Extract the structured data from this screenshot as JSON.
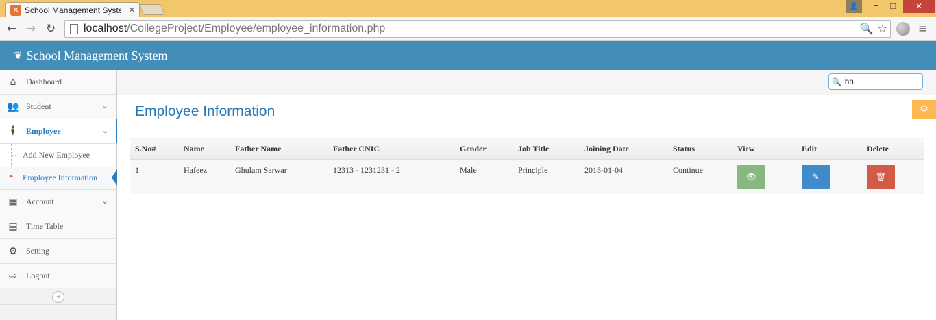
{
  "browser": {
    "tab_title": "School Management System",
    "url_host": "localhost",
    "url_path": "/CollegeProject/Employee/employee_information.php"
  },
  "app": {
    "brand": "School Management System",
    "search_value": "ha",
    "page_title": "Employee Information"
  },
  "sidebar": {
    "items": [
      {
        "label": "Dashboard",
        "icon": "home-icon"
      },
      {
        "label": "Student",
        "icon": "users-icon"
      },
      {
        "label": "Employee",
        "icon": "employee-icon"
      },
      {
        "label": "Account",
        "icon": "calculator-icon"
      },
      {
        "label": "Time Table",
        "icon": "calendar-icon"
      },
      {
        "label": "Setting",
        "icon": "gear-icon"
      },
      {
        "label": "Logout",
        "icon": "logout-icon"
      }
    ],
    "employee_sub": [
      {
        "label": "Add New Employee"
      },
      {
        "label": "Employee Information"
      }
    ]
  },
  "table": {
    "headers": [
      "S.No#",
      "Name",
      "Father Name",
      "Father CNIC",
      "Gender",
      "Job Title",
      "Joining Date",
      "Status",
      "View",
      "Edit",
      "Delete"
    ],
    "rows": [
      {
        "sno": "1",
        "name": "Hafeez",
        "father_name": "Ghulam Sarwar",
        "father_cnic": "12313 - 1231231 - 2",
        "gender": "Male",
        "job_title": "Principle",
        "joining_date": "2018-01-04",
        "status": "Continue"
      }
    ]
  },
  "colors": {
    "header_blue": "#438eb9",
    "title_blue": "#2679b5",
    "view_green": "#87b87f",
    "edit_blue": "#428bca",
    "delete_red": "#d15b47",
    "settings_orange": "#ffb752"
  }
}
